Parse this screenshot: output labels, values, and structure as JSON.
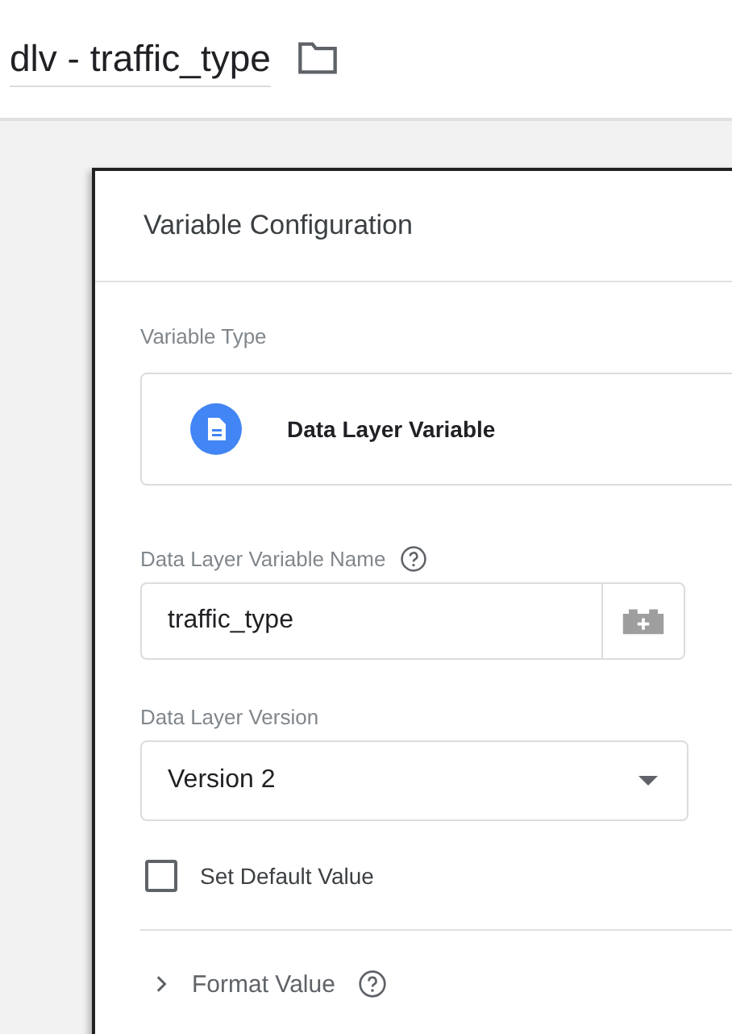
{
  "header": {
    "title": "dlv - traffic_type"
  },
  "card": {
    "title": "Variable Configuration",
    "variable_type": {
      "label": "Variable Type",
      "value": "Data Layer Variable"
    },
    "name_field": {
      "label": "Data Layer Variable Name",
      "value": "traffic_type",
      "help": true
    },
    "version_select": {
      "label": "Data Layer Version",
      "value": "Version 2"
    },
    "default_checkbox": {
      "label": "Set Default Value",
      "checked": false
    },
    "format_section": {
      "label": "Format Value",
      "expanded": false,
      "help": true
    }
  }
}
